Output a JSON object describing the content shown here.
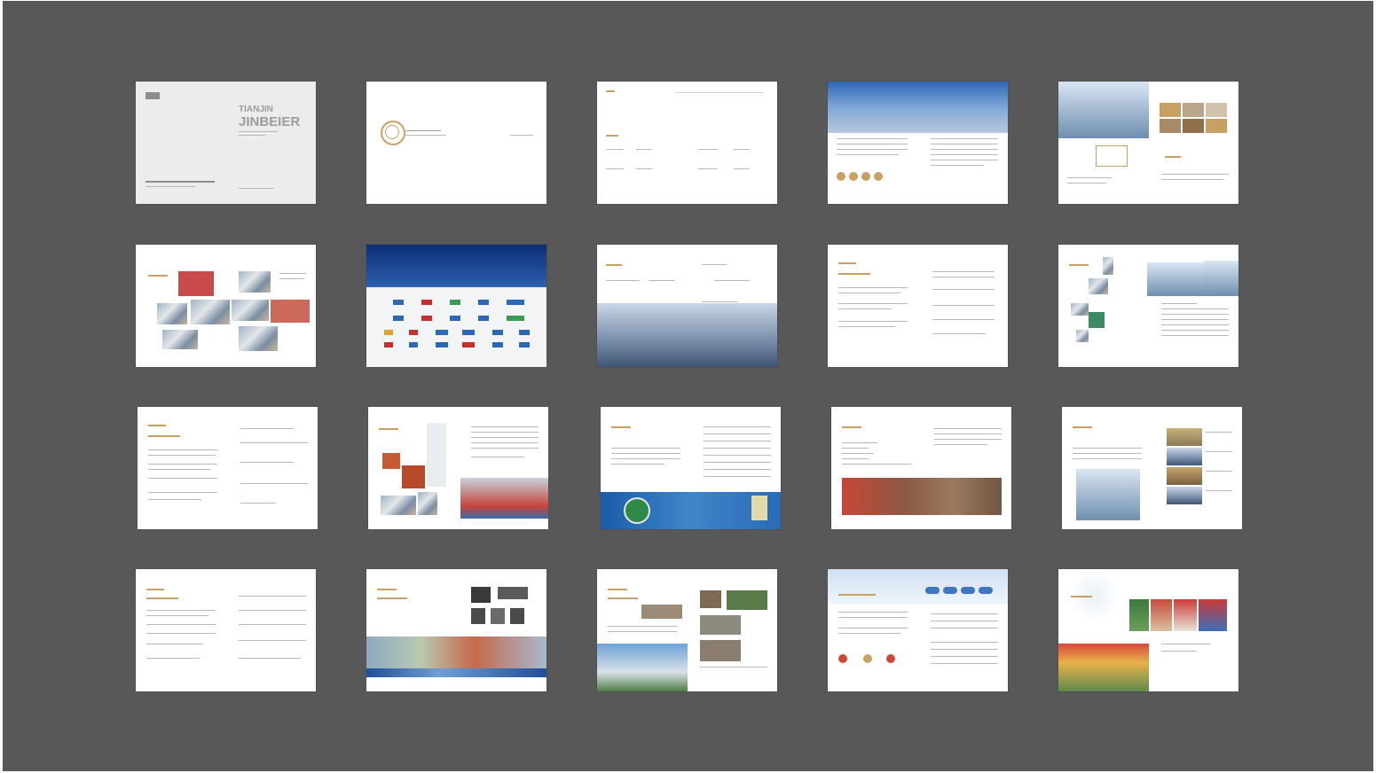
{
  "cover": {
    "title_line1": "TIANJIN",
    "title_line2": "JINBEIER"
  },
  "colors": {
    "background": "#575857",
    "page": "#ffffff",
    "accent_gold": "#c9a063",
    "brand_blue": "#2d67b8"
  }
}
